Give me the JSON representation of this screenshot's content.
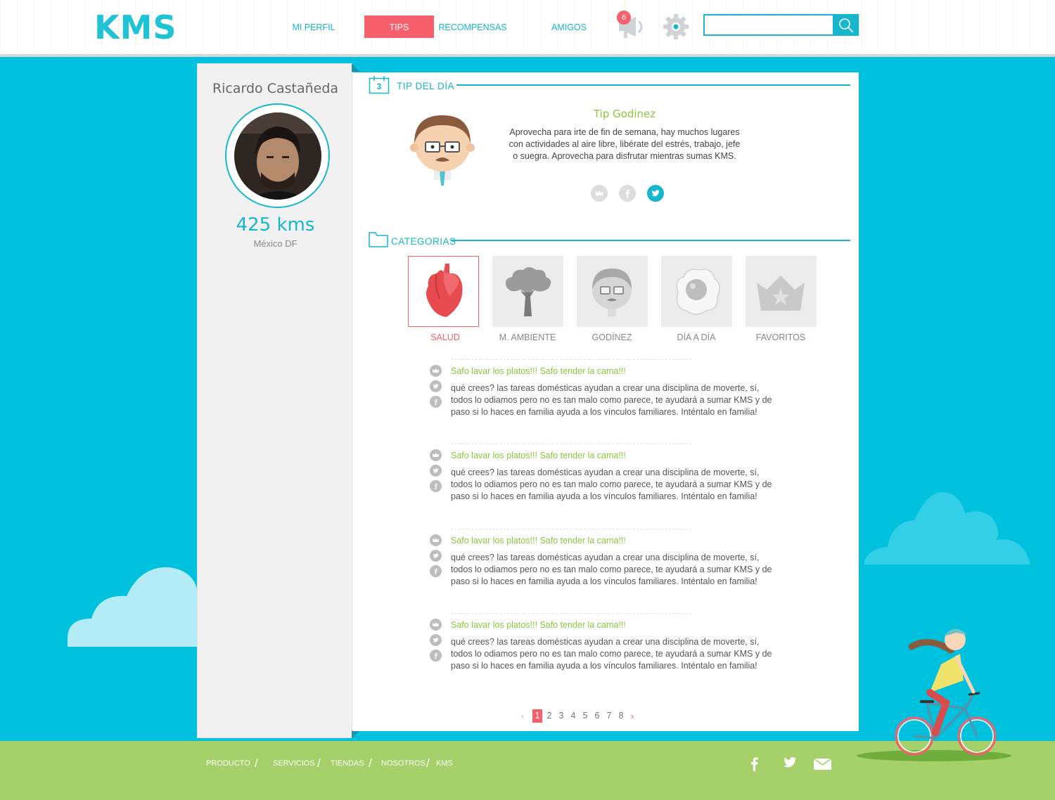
{
  "brand": {
    "logo": "KMS",
    "accent": "#16b6cf",
    "highlight": "#f5606c",
    "green": "#8cc63f",
    "sky": "#00c1dd",
    "grass": "#a6d16a"
  },
  "nav": {
    "items": [
      {
        "label": "MI PERFIL"
      },
      {
        "label": "TIPS"
      },
      {
        "label": "RECOMPENSAS"
      },
      {
        "label": "AMIGOS"
      }
    ],
    "active": "TIPS",
    "notifications_count": "6",
    "search": {
      "value": "",
      "placeholder": ""
    }
  },
  "user": {
    "name": "Ricardo Castañeda",
    "kms": "425 kms",
    "city": "México DF"
  },
  "tip_of_day": {
    "section_title": "TIP DEL DÍA",
    "calendar_day": "3",
    "title": "Tip Godinez",
    "text": "Aprovecha para irte de fin de semana, hay muchos lugares con actividades al aire libre, libérate del estrés, trabajo, jefe o suegra. Aprovecha para disfrutar mientras sumas KMS.",
    "share_icons": [
      "crown-icon",
      "facebook-icon",
      "twitter-icon"
    ]
  },
  "categories": {
    "section_title": "CATEGORIAS",
    "items": [
      {
        "label": "SALUD",
        "icon": "heart-icon",
        "active": true
      },
      {
        "label": "M. AMBIENTE",
        "icon": "tree-icon",
        "active": false
      },
      {
        "label": "GODÍNEZ",
        "icon": "godinez-face-icon",
        "active": false
      },
      {
        "label": "DÍA A DÍA",
        "icon": "fried-egg-icon",
        "active": false
      },
      {
        "label": "FAVORITOS",
        "icon": "crown-icon",
        "active": false
      }
    ]
  },
  "tips": [
    {
      "title": "Safo lavar los platos!!! Safo tender la cama!!!",
      "body": "qué crees? las tareas domésticas ayudan a crear una disciplina de moverte, sí, todos lo odiamos pero no es tan malo como parece, te ayudará a sumar KMS y de paso si lo haces en familia ayuda a los vínculos familiares. Inténtalo en familia!"
    },
    {
      "title": "Safo lavar los platos!!! Safo tender la cama!!!",
      "body": "qué crees? las tareas domésticas ayudan a crear una disciplina de moverte, sí, todos lo odiamos pero no es tan malo como parece, te ayudará a sumar KMS y de paso si lo haces en familia ayuda a los vínculos familiares. Inténtalo en familia!"
    },
    {
      "title": "Safo lavar los platos!!! Safo tender la cama!!!",
      "body": "qué crees? las tareas domésticas ayudan a crear una disciplina de moverte, sí, todos lo odiamos pero no es tan malo como parece, te ayudará a sumar KMS y de paso si lo haces en familia ayuda a los vínculos familiares. Inténtalo en familia!"
    },
    {
      "title": "Safo lavar los platos!!! Safo tender la cama!!!",
      "body": "qué crees? las tareas domésticas ayudan a crear una disciplina de moverte, sí, todos lo odiamos pero no es tan malo como parece, te ayudará a sumar KMS y de paso si lo haces en familia ayuda a los vínculos familiares. Inténtalo en familia!"
    }
  ],
  "pagination": {
    "pages": [
      "1",
      "2",
      "3",
      "4",
      "5",
      "6",
      "7",
      "8"
    ],
    "current": "1",
    "prev": "‹",
    "next": "›"
  },
  "footer": {
    "links": [
      "PRODUCTO",
      "SERVICIOS",
      "TIENDAS",
      "NOSOTROS",
      "KMS"
    ],
    "separator": "/",
    "social_icons": [
      "facebook-icon",
      "twitter-icon",
      "mail-icon"
    ]
  }
}
